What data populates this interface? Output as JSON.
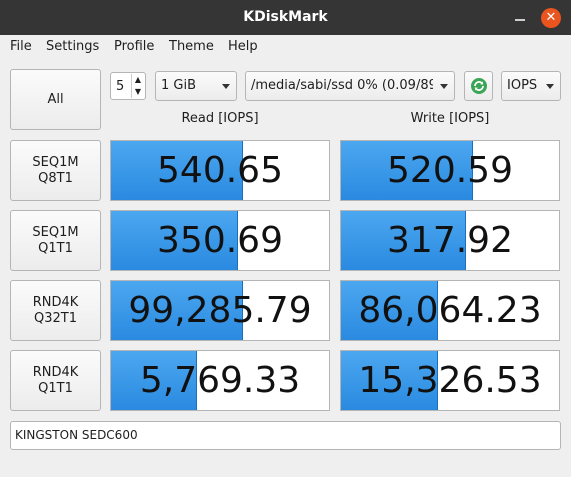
{
  "window": {
    "title": "KDiskMark"
  },
  "menu": [
    "File",
    "Settings",
    "Profile",
    "Theme",
    "Help"
  ],
  "controls": {
    "all_label": "All",
    "runs_value": "5",
    "size_value": "1 GiB",
    "path_value": "/media/sabi/ssd 0% (0.09/89",
    "units_value": "IOPS"
  },
  "columns": {
    "read": "Read [IOPS]",
    "write": "Write [IOPS]"
  },
  "tests": [
    {
      "name_line1": "SEQ1M",
      "name_line2": "Q8T1",
      "read": "540.65",
      "read_fill": 0.6,
      "write": "520.59",
      "write_fill": 0.6
    },
    {
      "name_line1": "SEQ1M",
      "name_line2": "Q1T1",
      "read": "350.69",
      "read_fill": 0.58,
      "write": "317.92",
      "write_fill": 0.57
    },
    {
      "name_line1": "RND4K",
      "name_line2": "Q32T1",
      "read": "99,285.79",
      "read_fill": 0.6,
      "write": "86,064.23",
      "write_fill": 0.44
    },
    {
      "name_line1": "RND4K",
      "name_line2": "Q1T1",
      "read": "5,769.33",
      "read_fill": 0.39,
      "write": "15,326.53",
      "write_fill": 0.44
    }
  ],
  "device": "KINGSTON SEDC600"
}
